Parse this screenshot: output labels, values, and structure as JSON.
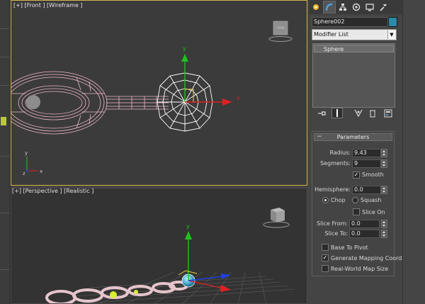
{
  "viewports": {
    "front": {
      "label": "[+] [Front ] [Wireframe ]",
      "active": true
    },
    "perspective": {
      "label": "[+] [Perspective ] [Realistic ]",
      "active": false
    }
  },
  "axes": {
    "x": "x",
    "y": "y",
    "z": "z"
  },
  "viewcube": {
    "top_label": "[TOP]"
  },
  "command_panel": {
    "tabs": [
      "create-icon",
      "modify-icon",
      "hierarchy-icon",
      "motion-icon",
      "display-icon",
      "utilities-icon"
    ],
    "active_tab": "modify",
    "object_name": "Sphere002",
    "object_color": "#2a8aa7",
    "modifier_list": "Modifier List",
    "modifier_stack": [
      "Sphere"
    ],
    "stack_tools": [
      "pin-stack-icon",
      "show-end-result-icon",
      "make-unique-icon",
      "remove-modifier-icon",
      "configure-modifier-sets-icon"
    ]
  },
  "parameters": {
    "title": "Parameters",
    "radius_label": "Radius:",
    "radius": "9.43",
    "segments_label": "Segments:",
    "segments": "9",
    "smooth_label": "Smooth",
    "smooth": true,
    "hemisphere_label": "Hemisphere:",
    "hemisphere": "0.0",
    "chop_label": "Chop",
    "squash_label": "Squash",
    "mode": "Chop",
    "slice_on_label": "Slice On",
    "slice_on": false,
    "slice_from_label": "Slice From:",
    "slice_from": "0.0",
    "slice_to_label": "Slice To:",
    "slice_to": "0.0",
    "base_to_pivot_label": "Base To Pivot",
    "base_to_pivot": false,
    "generate_mapping_label": "Generate Mapping Coords",
    "generate_mapping": true,
    "real_world_label": "Real-World Map Size",
    "real_world": false
  },
  "colors": {
    "active_viewport_border": "#d4b34a",
    "wire_color": "#f0b8c8",
    "selection_white": "#ffffff",
    "axis_x": "#e02020",
    "axis_y": "#20c020",
    "axis_z": "#2040e0",
    "chain_shaded": "#e6c4cc",
    "sphere_shaded": "#4fb0d4"
  }
}
